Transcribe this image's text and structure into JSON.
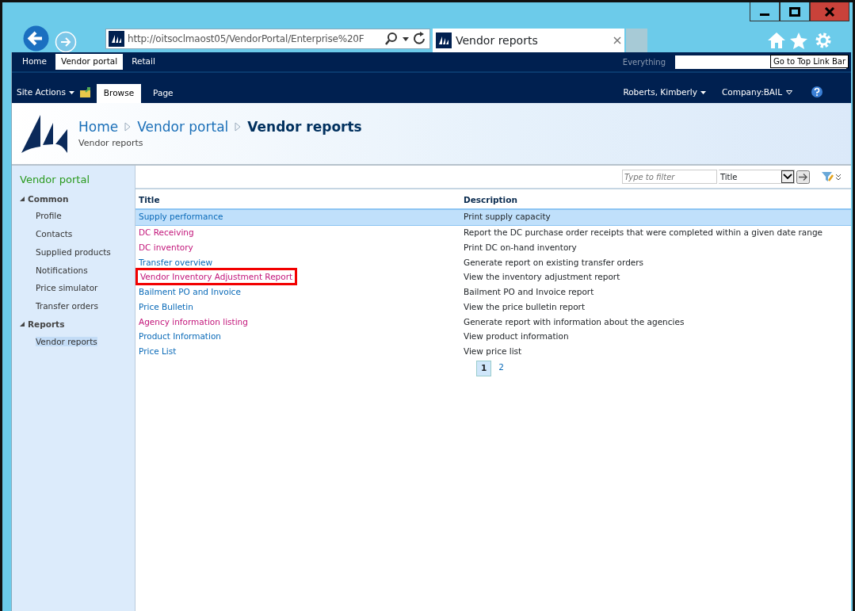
{
  "browser": {
    "address": "http://oitsoclmaost05/VendorPortal/Enterprise%20F",
    "tab_title": "Vendor reports"
  },
  "top_nav": {
    "tabs": [
      {
        "label": "Home",
        "selected": false
      },
      {
        "label": "Vendor portal",
        "selected": true
      },
      {
        "label": "Retail",
        "selected": false
      }
    ],
    "search_scope": "Everything",
    "tooltip": "Go to Top Link Bar"
  },
  "ribbon": {
    "site_actions": "Site Actions",
    "tabs": [
      {
        "label": "Browse",
        "selected": true
      },
      {
        "label": "Page",
        "selected": false
      }
    ],
    "user": "Roberts, Kimberly",
    "company": "Company:BAIL"
  },
  "header": {
    "breadcrumb": [
      {
        "label": "Home",
        "current": false
      },
      {
        "label": "Vendor portal",
        "current": false
      },
      {
        "label": "Vendor reports",
        "current": true
      }
    ],
    "subtitle": "Vendor reports"
  },
  "sidebar": {
    "title": "Vendor portal",
    "groups": [
      {
        "label": "Common",
        "expanded": true,
        "children": [
          {
            "label": "Profile",
            "selected": false
          },
          {
            "label": "Contacts",
            "selected": false
          },
          {
            "label": "Supplied products",
            "selected": false
          },
          {
            "label": "Notifications",
            "selected": false
          },
          {
            "label": "Price simulator",
            "selected": false
          },
          {
            "label": "Transfer orders",
            "selected": false
          }
        ]
      },
      {
        "label": "Reports",
        "expanded": true,
        "children": [
          {
            "label": "Vendor reports",
            "selected": true
          }
        ]
      }
    ]
  },
  "filter": {
    "placeholder": "Type to filter",
    "field": "Title"
  },
  "table": {
    "columns": [
      "Title",
      "Description"
    ],
    "rows": [
      {
        "title": "Supply performance",
        "description": "Print supply capacity",
        "selected": true,
        "visited": false,
        "annotated": false
      },
      {
        "title": "DC Receiving",
        "description": "Report the DC purchase order receipts that were completed within a given date range",
        "selected": false,
        "visited": true,
        "annotated": false
      },
      {
        "title": "DC inventory",
        "description": "Print DC on-hand inventory",
        "selected": false,
        "visited": true,
        "annotated": false
      },
      {
        "title": "Transfer overview",
        "description": "Generate report on existing transfer orders",
        "selected": false,
        "visited": false,
        "annotated": false
      },
      {
        "title": "Vendor Inventory Adjustment Report",
        "description": "View the inventory adjustment report",
        "selected": false,
        "visited": true,
        "annotated": true
      },
      {
        "title": "Bailment PO and Invoice",
        "description": "Bailment PO and Invoice report",
        "selected": false,
        "visited": false,
        "annotated": false
      },
      {
        "title": "Price Bulletin",
        "description": "View the price bulletin report",
        "selected": false,
        "visited": false,
        "annotated": false
      },
      {
        "title": "Agency information listing",
        "description": "Generate report with information about the agencies",
        "selected": false,
        "visited": true,
        "annotated": false
      },
      {
        "title": "Product Information",
        "description": "View product information",
        "selected": false,
        "visited": false,
        "annotated": false
      },
      {
        "title": "Price List",
        "description": "View price list",
        "selected": false,
        "visited": false,
        "annotated": false
      }
    ]
  },
  "pager": [
    {
      "label": "1",
      "selected": true
    },
    {
      "label": "2",
      "selected": false
    }
  ]
}
